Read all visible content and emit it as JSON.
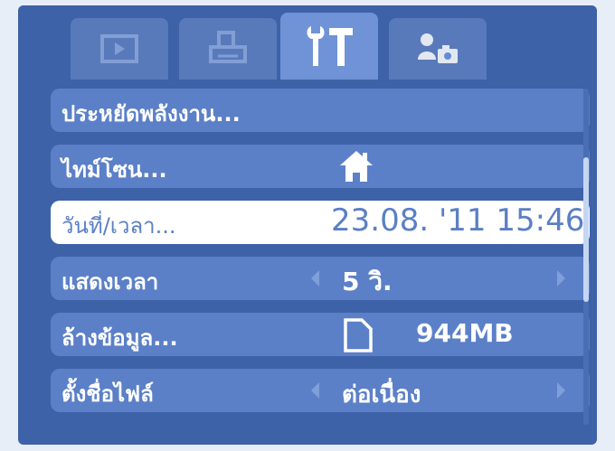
{
  "tabs": [
    {
      "icon": "playback-icon",
      "active": false
    },
    {
      "icon": "print-icon",
      "active": false
    },
    {
      "icon": "settings-tools-icon",
      "active": true
    },
    {
      "icon": "my-camera-icon",
      "active": false
    }
  ],
  "menu": {
    "items": [
      {
        "label": "ประหยัดพลังงาน...",
        "value": ""
      },
      {
        "label": "ไทม์โซน...",
        "value": "",
        "icon": "home-icon"
      },
      {
        "label": "วันที่/เวลา...",
        "value": "23.08. '11 15:46",
        "selected": true
      },
      {
        "label": "แสดงเวลา",
        "value": "5 วิ."
      },
      {
        "label": "ล้างข้อมูล...",
        "value": "944MB",
        "icon": "memory-card-icon"
      },
      {
        "label": "ตั้งชื่อไฟล์",
        "value": "ต่อเนื่อง"
      }
    ]
  },
  "colors": {
    "background": "#3d62a8",
    "row": "#5b80c8",
    "selected_row": "#ffffff",
    "selected_text": "#5a7fc4",
    "text": "#ffffff"
  }
}
